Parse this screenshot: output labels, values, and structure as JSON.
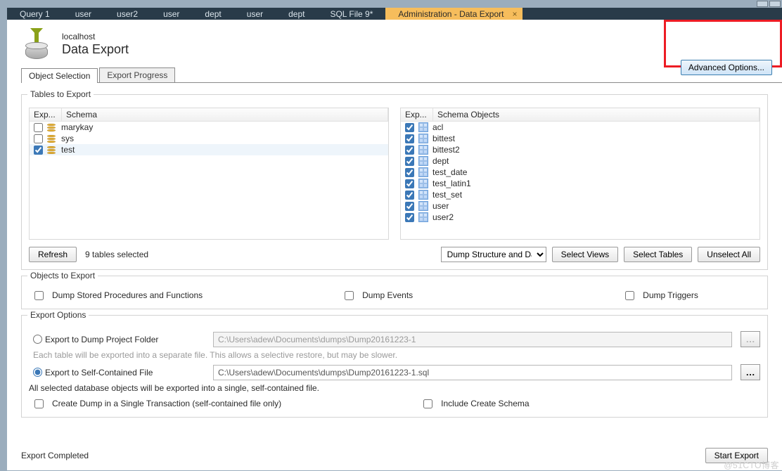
{
  "window_tabs": [
    "Query 1",
    "user",
    "user2",
    "user",
    "dept",
    "user",
    "dept",
    "SQL File 9*"
  ],
  "active_tab": "Administration - Data Export",
  "header": {
    "host": "localhost",
    "title": "Data Export",
    "advanced_button": "Advanced Options..."
  },
  "subtabs": {
    "object_selection": "Object Selection",
    "export_progress": "Export Progress"
  },
  "tables_group": {
    "legend": "Tables to Export",
    "schema_header_c1": "Exp...",
    "schema_header_c2": "Schema",
    "schemas": [
      {
        "checked": false,
        "name": "marykay"
      },
      {
        "checked": false,
        "name": "sys"
      },
      {
        "checked": true,
        "name": "test"
      }
    ],
    "objects_header_c1": "Exp...",
    "objects_header_c2": "Schema Objects",
    "objects": [
      {
        "checked": true,
        "name": "acl"
      },
      {
        "checked": true,
        "name": "bittest"
      },
      {
        "checked": true,
        "name": "bittest2"
      },
      {
        "checked": true,
        "name": "dept"
      },
      {
        "checked": true,
        "name": "test_date"
      },
      {
        "checked": true,
        "name": "test_latin1"
      },
      {
        "checked": true,
        "name": "test_set"
      },
      {
        "checked": true,
        "name": "user"
      },
      {
        "checked": true,
        "name": "user2"
      }
    ],
    "refresh": "Refresh",
    "selected_count": "9 tables selected",
    "dump_mode": "Dump Structure and Dat",
    "select_views": "Select Views",
    "select_tables": "Select Tables",
    "unselect_all": "Unselect All"
  },
  "objects_group": {
    "legend": "Objects to Export",
    "dump_sp": "Dump Stored Procedures and Functions",
    "dump_events": "Dump Events",
    "dump_triggers": "Dump Triggers"
  },
  "export_options": {
    "legend": "Export Options",
    "radio_folder": "Export to Dump Project Folder",
    "folder_path": "C:\\Users\\adew\\Documents\\dumps\\Dump20161223-1",
    "folder_hint": "Each table will be exported into a separate file. This allows a selective restore, but may be slower.",
    "radio_file": "Export to Self-Contained File",
    "file_path": "C:\\Users\\adew\\Documents\\dumps\\Dump20161223-1.sql",
    "file_hint": "All selected database objects will be exported into a single, self-contained file.",
    "single_txn": "Create Dump in a Single Transaction (self-contained file only)",
    "include_schema": "Include Create Schema"
  },
  "footer": {
    "status": "Export Completed",
    "start": "Start Export"
  },
  "watermark": "@51CTO博客"
}
